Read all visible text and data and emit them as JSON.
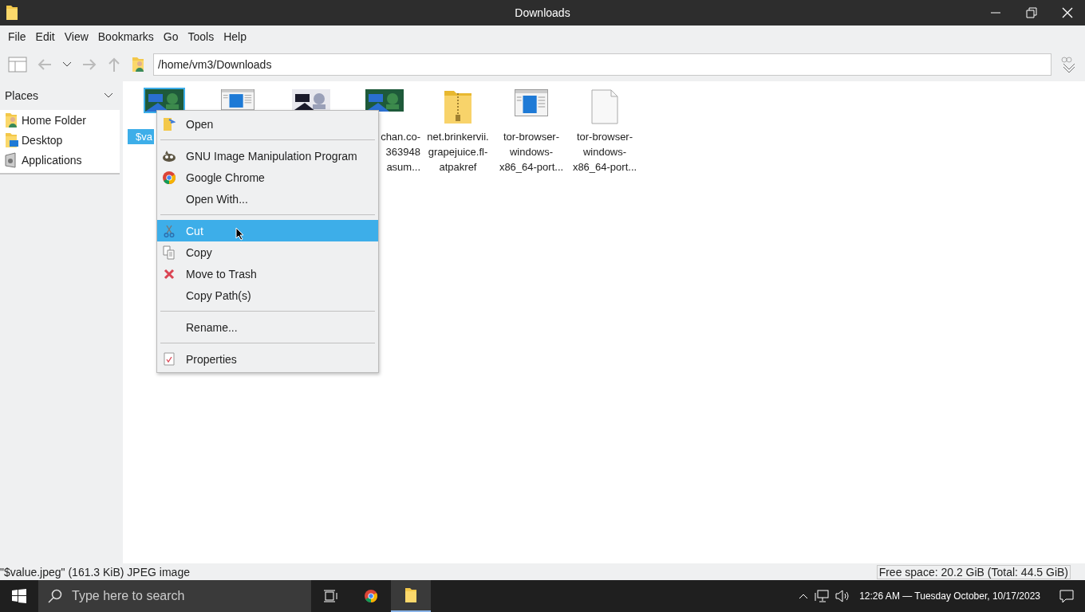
{
  "window": {
    "title": "Downloads"
  },
  "menubar": [
    "File",
    "Edit",
    "View",
    "Bookmarks",
    "Go",
    "Tools",
    "Help"
  ],
  "address": {
    "value": "/home/vm3/Downloads"
  },
  "sidebar": {
    "title": "Places",
    "items": [
      {
        "label": "Home Folder",
        "kind": "home"
      },
      {
        "label": "Desktop",
        "kind": "desktop"
      },
      {
        "label": "Applications",
        "kind": "apps"
      }
    ]
  },
  "files": [
    {
      "kind": "picture",
      "lines": [
        "$va"
      ],
      "selected": true
    },
    {
      "kind": "window",
      "selected": false
    },
    {
      "kind": "picture",
      "selected": false
    },
    {
      "kind": "picture",
      "lines": [
        "chan.co-",
        "363948",
        "asum..."
      ],
      "selected": false
    },
    {
      "kind": "zip",
      "lines": [
        "net.brinkervii.",
        "grapejuice.fl-",
        "atpakref"
      ],
      "selected": false
    },
    {
      "kind": "window",
      "lines": [
        "tor-browser-",
        "windows-",
        "x86_64-port..."
      ],
      "selected": false
    },
    {
      "kind": "doc",
      "lines": [
        "tor-browser-",
        "windows-",
        "x86_64-port..."
      ],
      "selected": false
    }
  ],
  "context_menu": [
    {
      "kind": "open",
      "label": "Open",
      "selected": false
    },
    {
      "kind": "separator"
    },
    {
      "kind": "gimp",
      "label": "GNU Image Manipulation Program",
      "selected": false
    },
    {
      "kind": "chrome",
      "label": "Google Chrome",
      "selected": false
    },
    {
      "kind": "plain",
      "label": "Open With...",
      "selected": false
    },
    {
      "kind": "separator"
    },
    {
      "kind": "cut",
      "label": "Cut",
      "selected": true
    },
    {
      "kind": "copy",
      "label": "Copy",
      "selected": false
    },
    {
      "kind": "trash",
      "label": "Move to Trash",
      "selected": false
    },
    {
      "kind": "plain",
      "label": "Copy Path(s)",
      "selected": false
    },
    {
      "kind": "separator"
    },
    {
      "kind": "plain",
      "label": "Rename...",
      "selected": false
    },
    {
      "kind": "separator"
    },
    {
      "kind": "properties",
      "label": "Properties",
      "selected": false
    }
  ],
  "status_bar": {
    "info": "\"$value.jpeg\" (161.3 KiB) JPEG image",
    "free_space": "Free space: 20.2 GiB (Total: 44.5 GiB)"
  },
  "taskbar": {
    "search_placeholder": "Type here to search",
    "clock": "12:26 AM — Tuesday October, 10/17/2023"
  }
}
